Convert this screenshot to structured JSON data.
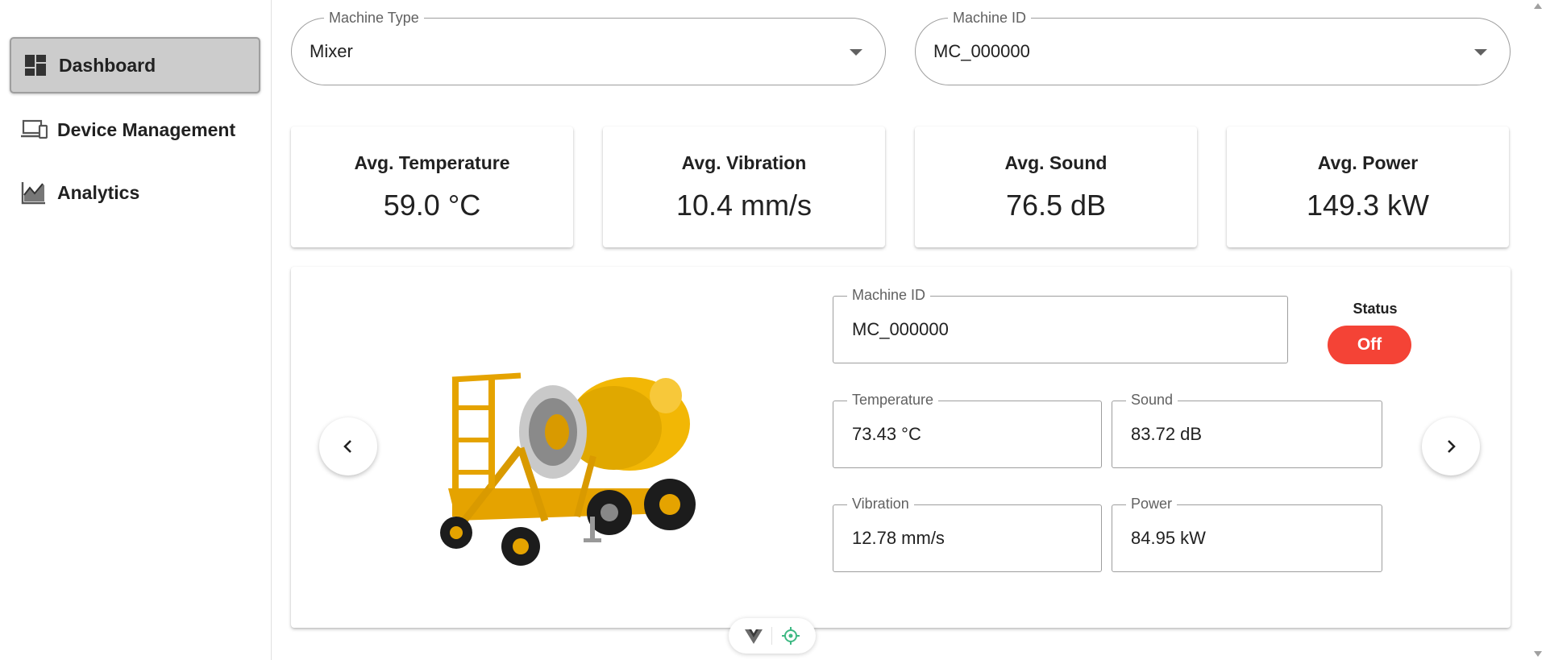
{
  "sidebar": {
    "items": [
      {
        "label": "Dashboard",
        "icon": "dashboard-icon",
        "active": true
      },
      {
        "label": "Device Management",
        "icon": "devices-icon",
        "active": false
      },
      {
        "label": "Analytics",
        "icon": "analytics-icon",
        "active": false
      }
    ]
  },
  "filters": {
    "machine_type": {
      "label": "Machine Type",
      "value": "Mixer"
    },
    "machine_id": {
      "label": "Machine ID",
      "value": "MC_000000"
    }
  },
  "stats": [
    {
      "title": "Avg. Temperature",
      "value": "59.0 °C"
    },
    {
      "title": "Avg. Vibration",
      "value": "10.4 mm/s"
    },
    {
      "title": "Avg. Sound",
      "value": "76.5 dB"
    },
    {
      "title": "Avg. Power",
      "value": "149.3 kW"
    }
  ],
  "detail": {
    "machine_id": {
      "label": "Machine ID",
      "value": "MC_000000"
    },
    "status": {
      "label": "Status",
      "value": "Off",
      "color": "#f44336"
    },
    "temperature": {
      "label": "Temperature",
      "value": "73.43 °C"
    },
    "sound": {
      "label": "Sound",
      "value": "83.72 dB"
    },
    "vibration": {
      "label": "Vibration",
      "value": "12.78 mm/s"
    },
    "power": {
      "label": "Power",
      "value": "84.95 kW"
    },
    "image": "concrete-mixer-image"
  },
  "colors": {
    "active_nav_bg": "#cccccc",
    "status_off": "#f44336",
    "mixer_yellow": "#f2b705"
  }
}
